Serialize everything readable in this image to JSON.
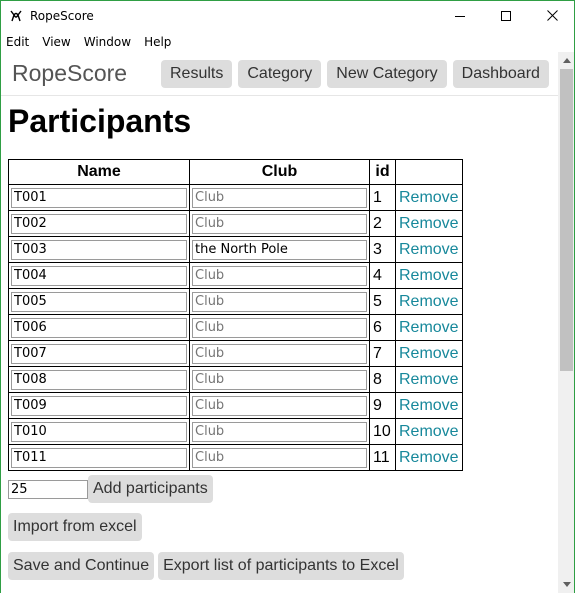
{
  "window": {
    "title": "RopeScore"
  },
  "menu": [
    "Edit",
    "View",
    "Window",
    "Help"
  ],
  "nav": {
    "brand": "RopeScore",
    "buttons": [
      "Results",
      "Category",
      "New Category",
      "Dashboard"
    ]
  },
  "page": {
    "title": "Participants"
  },
  "table": {
    "headers": [
      "Name",
      "Club",
      "id",
      ""
    ],
    "club_placeholder": "Club",
    "remove_label": "Remove",
    "rows": [
      {
        "name": "T001",
        "club": "",
        "id": "1"
      },
      {
        "name": "T002",
        "club": "",
        "id": "2"
      },
      {
        "name": "T003",
        "club": "the North Pole",
        "id": "3"
      },
      {
        "name": "T004",
        "club": "",
        "id": "4"
      },
      {
        "name": "T005",
        "club": "",
        "id": "5"
      },
      {
        "name": "T006",
        "club": "",
        "id": "6"
      },
      {
        "name": "T007",
        "club": "",
        "id": "7"
      },
      {
        "name": "T008",
        "club": "",
        "id": "8"
      },
      {
        "name": "T009",
        "club": "",
        "id": "9"
      },
      {
        "name": "T010",
        "club": "",
        "id": "10"
      },
      {
        "name": "T011",
        "club": "",
        "id": "11"
      }
    ]
  },
  "add": {
    "count_value": "25",
    "button_label": "Add participants"
  },
  "actions": {
    "import_label": "Import from excel",
    "save_label": "Save and Continue",
    "export_label": "Export list of participants to Excel"
  },
  "colors": {
    "link": "#17889b",
    "button_bg": "#dddddd",
    "window_border": "#2f9e44"
  }
}
